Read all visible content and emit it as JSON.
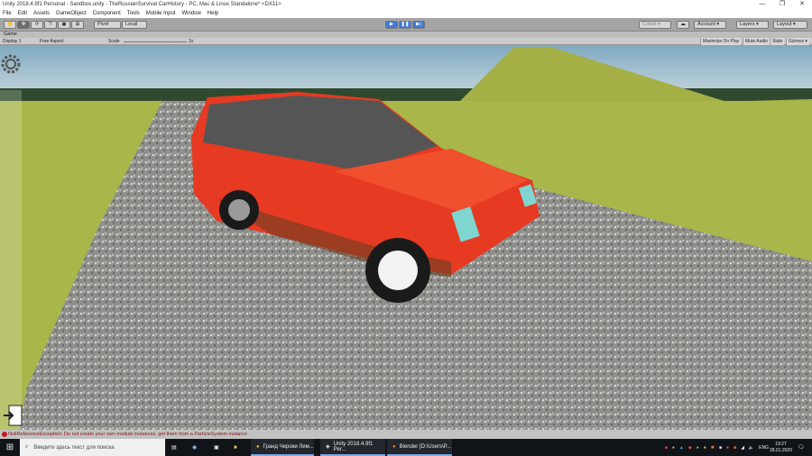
{
  "window": {
    "title": "Unity 2018.4.9f1 Personal - Sandbox.unity - TheRussianSurvival CarHistory - PC, Mac & Linux Standalone* <DX11>",
    "minimize": "—",
    "restore": "❐",
    "close": "✕"
  },
  "menu": [
    "File",
    "Edit",
    "Assets",
    "GameObject",
    "Component",
    "Tools",
    "Mobile Input",
    "Window",
    "Help"
  ],
  "toolbar": {
    "tools": [
      "✋",
      "✥",
      "⟳",
      "⤧",
      "▣",
      "⊞"
    ],
    "pivot": "Pivot",
    "local": "Local",
    "play": "▶",
    "pause": "❚❚",
    "step": "▶|",
    "collab": "Collab ▾",
    "cloud": "☁",
    "account": "Account ▾",
    "layers": "Layers ▾",
    "layout": "Layout ▾"
  },
  "game": {
    "tab": "Game",
    "display": "Display 1",
    "aspect": "Free Aspect",
    "scale_label": "Scale",
    "scale_value": "1x",
    "maximize": "Maximize On Play",
    "mute": "Mute Audio",
    "stats": "Stats",
    "gizmos": "Gizmos ▾"
  },
  "status": {
    "message": "NullReferenceException: Do not create your own module instances, get them from a ParticleSystem instance",
    "color": "#c91717"
  },
  "taskbar": {
    "search_placeholder": "Введите здесь текст для поиска",
    "apps": [
      "Гранд Чероки Лим...",
      "Unity 2018.4.9f1 Per...",
      "Blender [D:\\Users\\P..."
    ],
    "lang": "ENG",
    "time": "19:27",
    "date": "28.01.2020"
  },
  "colors": {
    "car": "#e63a22",
    "sky": "#8fb5c9",
    "grass": "#a7b548"
  }
}
